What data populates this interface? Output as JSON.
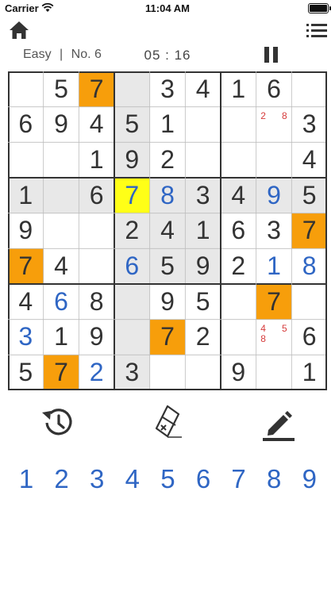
{
  "status_bar": {
    "carrier": "Carrier",
    "time": "11:04 AM"
  },
  "info": {
    "difficulty": "Easy",
    "separator": "|",
    "puzzle_number": "No. 6",
    "timer": "05 : 16"
  },
  "colors": {
    "accent_blue": "#2f66c4",
    "highlight_gray": "#e8e8e8",
    "conflict_orange": "#f79e0b",
    "selected_yellow": "#ffff17",
    "note_red": "#d63b3b"
  },
  "board": {
    "rows": [
      [
        "",
        "5",
        "7",
        "",
        "3",
        "4",
        "1",
        "6",
        ""
      ],
      [
        "6",
        "9",
        "4",
        "5",
        "1",
        "",
        "",
        "",
        "3"
      ],
      [
        "",
        "",
        "1",
        "9",
        "2",
        "",
        "",
        "",
        "4"
      ],
      [
        "1",
        "",
        "6",
        "7",
        "8",
        "3",
        "4",
        "9",
        "5"
      ],
      [
        "9",
        "",
        "",
        "2",
        "4",
        "1",
        "6",
        "3",
        "7"
      ],
      [
        "7",
        "4",
        "",
        "6",
        "5",
        "9",
        "2",
        "1",
        "8"
      ],
      [
        "4",
        "6",
        "8",
        "",
        "9",
        "5",
        "",
        "7",
        ""
      ],
      [
        "3",
        "1",
        "9",
        "",
        "7",
        "2",
        "",
        "",
        "6"
      ],
      [
        "5",
        "7",
        "2",
        "3",
        "",
        "",
        "9",
        "",
        "1"
      ]
    ],
    "styles": [
      [
        "",
        "",
        "err",
        "hl",
        "",
        "",
        "",
        "",
        ""
      ],
      [
        "",
        "",
        "",
        "hl",
        "",
        "",
        "",
        "",
        ""
      ],
      [
        "",
        "",
        "",
        "hl",
        "",
        "",
        "",
        "",
        ""
      ],
      [
        "hl",
        "hl",
        "hl",
        "sel",
        "hl",
        "hl",
        "hl",
        "hl",
        "hl"
      ],
      [
        "",
        "",
        "",
        "hl",
        "hl",
        "hl",
        "",
        "",
        "err"
      ],
      [
        "err",
        "",
        "",
        "hl",
        "hl",
        "hl",
        "",
        "",
        ""
      ],
      [
        "",
        "",
        "",
        "hl",
        "",
        "",
        "",
        "err",
        ""
      ],
      [
        "",
        "",
        "",
        "hl",
        "err",
        "",
        "",
        "",
        ""
      ],
      [
        "",
        "err",
        "",
        "hl",
        "",
        "",
        "",
        "",
        ""
      ]
    ],
    "user_entries": [
      [
        3,
        3
      ],
      [
        3,
        4
      ],
      [
        3,
        7
      ],
      [
        5,
        3
      ],
      [
        5,
        7
      ],
      [
        5,
        8
      ],
      [
        6,
        1
      ],
      [
        7,
        0
      ],
      [
        8,
        2
      ]
    ],
    "notes": [
      {
        "row": 1,
        "col": 7,
        "marks": [
          {
            "digit": "2",
            "slot": 0
          },
          {
            "digit": "8",
            "slot": 2
          }
        ]
      },
      {
        "row": 7,
        "col": 7,
        "marks": [
          {
            "digit": "4",
            "slot": 0
          },
          {
            "digit": "5",
            "slot": 2
          },
          {
            "digit": "8",
            "slot": 3
          }
        ]
      }
    ]
  },
  "tools": [
    {
      "name": "undo-button",
      "icon": "history-undo-icon"
    },
    {
      "name": "erase-button",
      "icon": "eraser-icon"
    },
    {
      "name": "notes-button",
      "icon": "pencil-icon"
    }
  ],
  "numpad": [
    "1",
    "2",
    "3",
    "4",
    "5",
    "6",
    "7",
    "8",
    "9"
  ]
}
